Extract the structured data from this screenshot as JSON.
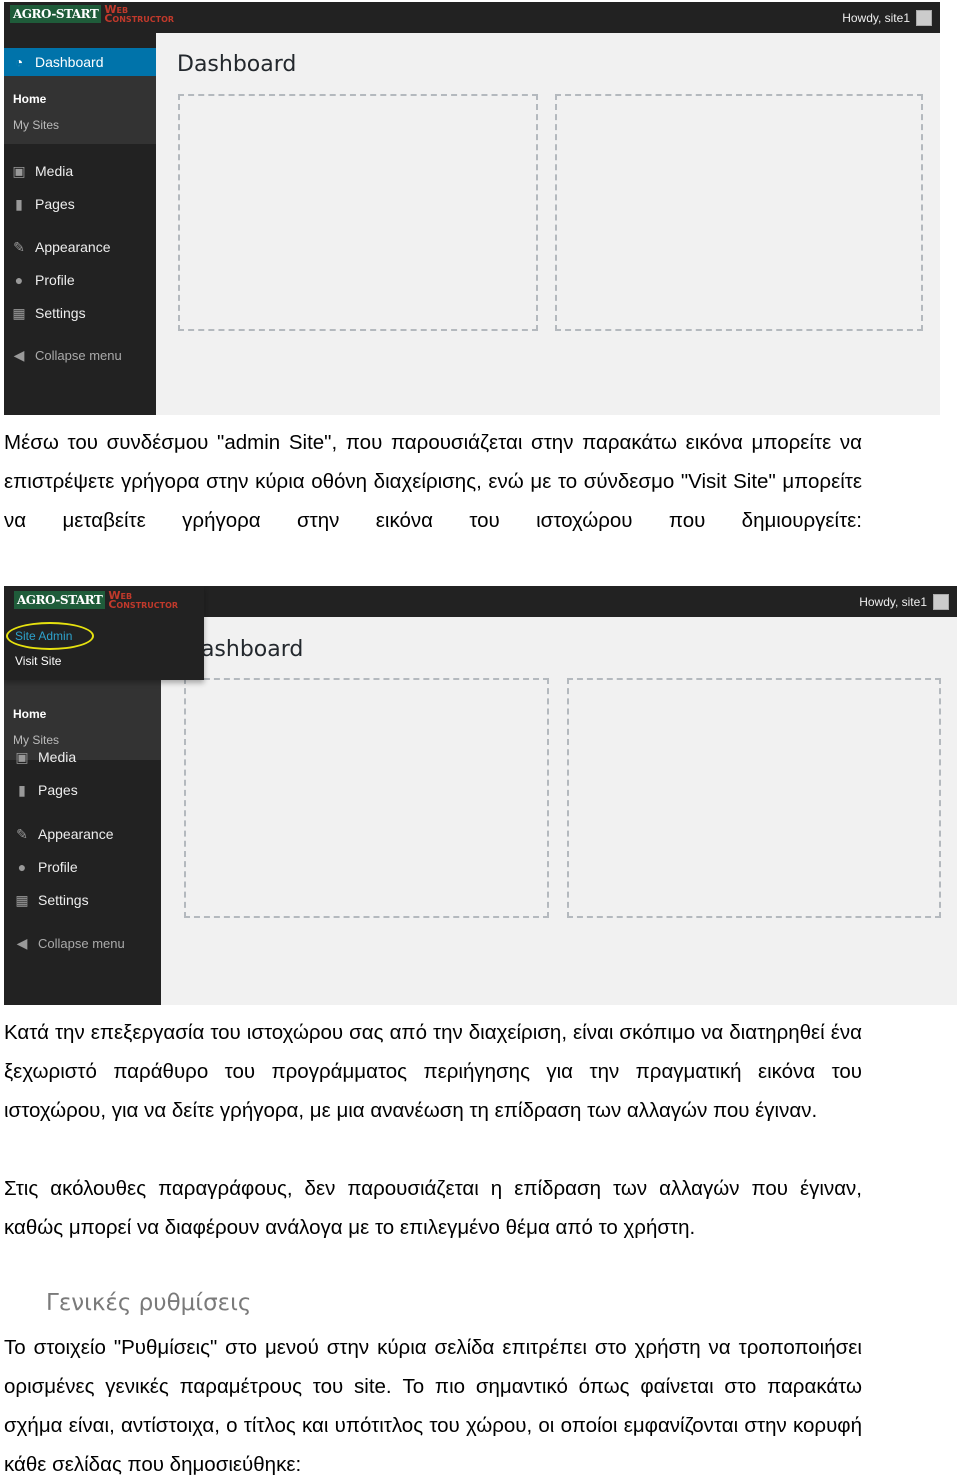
{
  "screenshot1": {
    "logo": {
      "brand": "AGRO-START",
      "sub1": "Web",
      "sub2": "Constructor"
    },
    "howdy": "Howdy, site1",
    "menu": {
      "dashboard": "Dashboard",
      "home": "Home",
      "my_sites": "My Sites",
      "media": "Media",
      "pages": "Pages",
      "appearance": "Appearance",
      "profile": "Profile",
      "settings": "Settings",
      "collapse": "Collapse menu"
    },
    "title": "Dashboard"
  },
  "screenshot2": {
    "logo": {
      "brand": "AGRO-START",
      "sub1": "Web",
      "sub2": "Constructor"
    },
    "howdy": "Howdy, site1",
    "dropdown": {
      "site_admin": "Site Admin",
      "visit_site": "Visit Site"
    },
    "menu": {
      "home": "Home",
      "my_sites": "My Sites",
      "media": "Media",
      "pages": "Pages",
      "appearance": "Appearance",
      "profile": "Profile",
      "settings": "Settings",
      "collapse": "Collapse menu"
    },
    "title": "Dashboard"
  },
  "paragraphs": {
    "p1": "Μέσω του συνδέσμου \"admin Site\", που παρουσιάζεται στην παρακάτω εικόνα μπορείτε να επιστρέψετε γρήγορα στην κύρια οθόνη διαχείρισης, ενώ με το σύνδεσμο \"Visit Site\" μπορείτε να μεταβείτε γρήγορα στην εικόνα του ιστοχώρου που δημιουργείτε:",
    "p2": "Κατά την επεξεργασία του ιστοχώρου σας από την διαχείριση, είναι σκόπιμο να διατηρηθεί ένα ξεχωριστό παράθυρο του προγράμματος περιήγησης για την πραγματική εικόνα του ιστοχώρου, για να δείτε γρήγορα, με μια ανανέωση τη επίδραση των αλλαγών που έγιναν.",
    "p3": "Στις ακόλουθες παραγράφους, δεν παρουσιάζεται η επίδραση των αλλαγών που έγιναν, καθώς μπορεί να διαφέρουν ανάλογα με το επιλεγμένο θέμα από το χρήστη.",
    "heading": "Γενικές ρυθμίσεις",
    "p4": "Το στοιχείο \"Ρυθμίσεις\" στο μενού στην κύρια σελίδα επιτρέπει στο χρήστη να τροποποιήσει ορισμένες γενικές παραμέτρους του site. Το πιο σημαντικό όπως φαίνεται στο παρακάτω σχήμα είναι, αντίστοιχα, ο τίτλος και υπότιτλος του χώρου, οι οποίοι εμφανίζονται στην κορυφή κάθε σελίδας που δημοσιεύθηκε:"
  },
  "colors": {
    "accent": "#0073aa",
    "adminbar": "#222222",
    "highlight": "#e6e20f"
  }
}
